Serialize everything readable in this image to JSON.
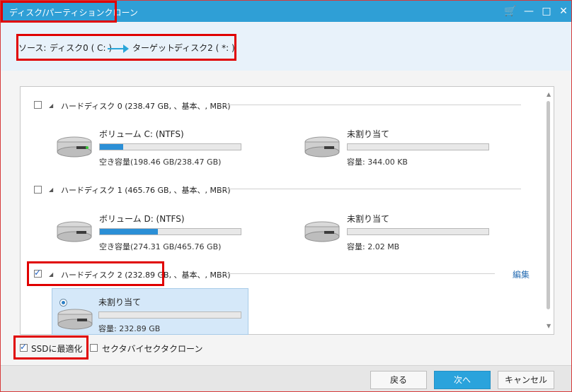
{
  "window": {
    "title": "ディスク/パーティションクローン",
    "controls": {
      "cart": "cart-icon",
      "minimize": "minimize-icon",
      "maximize": "maximize-icon",
      "close": "close-icon"
    }
  },
  "source_target": {
    "source_label": "ソース:",
    "source_value": "ディスク0 ( C: )",
    "target_label": "ターゲット:",
    "target_value": "ディスク2 ( *: )"
  },
  "disks": [
    {
      "label": "ハードディスク 0 (238.47 GB, 、基本、, MBR)",
      "checked": false,
      "partitions": [
        {
          "name": "ボリューム C: (NTFS)",
          "info": "空き容量(198.46 GB/238.47 GB)",
          "used_fraction": 0.168
        },
        {
          "name": "未割り当て",
          "info": "容量: 344.00 KB",
          "used_fraction": 0
        }
      ]
    },
    {
      "label": "ハードディスク 1 (465.76 GB, 、基本、, MBR)",
      "checked": false,
      "partitions": [
        {
          "name": "ボリューム D: (NTFS)",
          "info": "空き容量(274.31 GB/465.76 GB)",
          "used_fraction": 0.411
        },
        {
          "name": "未割り当て",
          "info": "容量: 2.02 MB",
          "used_fraction": 0
        }
      ]
    },
    {
      "label": "ハードディスク 2 (232.89 GB, 、基本、, MBR)",
      "checked": true,
      "edit_label": "編集",
      "partitions": [
        {
          "name": "未割り当て",
          "info": "容量: 232.89 GB",
          "used_fraction": 0,
          "selected": true
        }
      ]
    }
  ],
  "options": {
    "ssd_label": "SSDに最適化",
    "ssd_checked": true,
    "sector_label": "セクタバイセクタクローン",
    "sector_checked": false
  },
  "footer": {
    "back": "戻る",
    "next": "次へ",
    "cancel": "キャンセル"
  }
}
